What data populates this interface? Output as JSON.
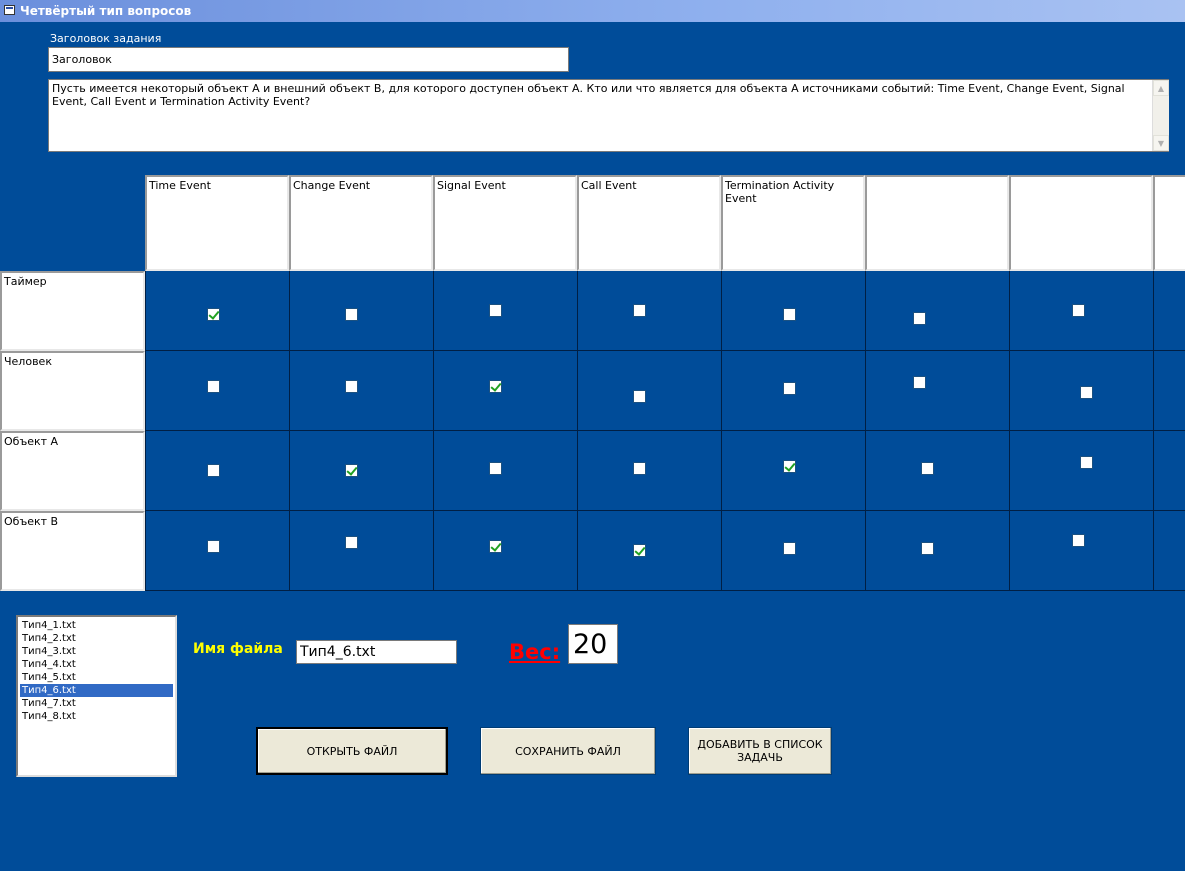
{
  "window": {
    "title": "Четвёртый тип вопросов"
  },
  "task_title_label": "Заголовок задания",
  "task_title_value": "Заголовок",
  "question_text": "Пусть имеется некоторый объект А и внешний объект В, для которого доступен объект А. Кто или что является для объекта А источниками событий: Time Event, Change Event, Signal Event, Call Event и Termination Activity Event?",
  "columns": [
    "Time Event",
    "Change Event",
    "Signal Event",
    "Call Event",
    "Termination Activity Event",
    "",
    "",
    ""
  ],
  "rows": [
    {
      "label": "Таймер",
      "checks": [
        true,
        false,
        false,
        false,
        false,
        false,
        false
      ]
    },
    {
      "label": "Человек",
      "checks": [
        false,
        false,
        true,
        false,
        false,
        false,
        false
      ]
    },
    {
      "label": "Объект А",
      "checks": [
        false,
        true,
        false,
        false,
        true,
        false,
        false
      ]
    },
    {
      "label": "Объект В",
      "checks": [
        false,
        false,
        true,
        true,
        false,
        false,
        false
      ]
    }
  ],
  "files": [
    "Тип4_1.txt",
    "Тип4_2.txt",
    "Тип4_3.txt",
    "Тип4_4.txt",
    "Тип4_5.txt",
    "Тип4_6.txt",
    "Тип4_7.txt",
    "Тип4_8.txt"
  ],
  "selected_file_index": 5,
  "filename_label": "Имя файла",
  "filename_value": "Тип4_6.txt",
  "weight_label": "Вес:",
  "weight_value": "20",
  "buttons": {
    "open": "ОТКРЫТЬ ФАЙЛ",
    "save": "СОХРАНИТЬ ФАЙЛ",
    "add": "ДОБАВИТЬ В СПИСОК ЗАДАЧЬ"
  },
  "colors": {
    "background": "#004c99",
    "title_bar": "#7b9fe4",
    "filename_label": "#ffff00",
    "weight_label": "#ff0000",
    "check": "#21a121",
    "list_selection": "#316ac5"
  }
}
